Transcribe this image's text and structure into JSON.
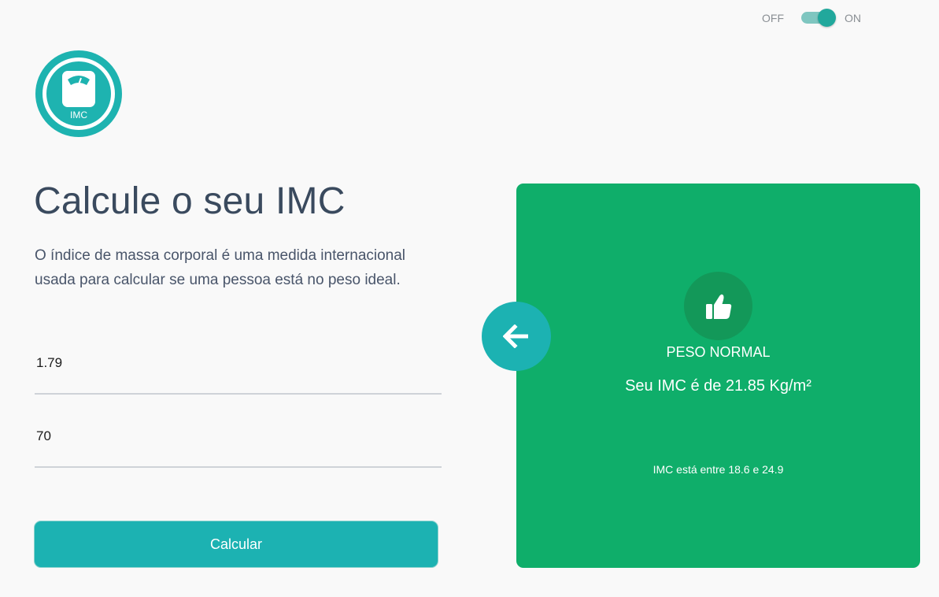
{
  "theme_toggle": {
    "off_label": "OFF",
    "on_label": "ON",
    "state": "on"
  },
  "logo": {
    "text": "IMC",
    "icon": "scale-icon",
    "color": "#1eb3b0"
  },
  "main": {
    "title": "Calcule o seu IMC",
    "description": "O índice de massa corporal é uma medida internacional usada para calcular se uma pessoa está no peso ideal."
  },
  "form": {
    "height_value": "1.79",
    "weight_value": "70",
    "submit_label": "Calcular"
  },
  "result": {
    "status": "PESO NORMAL",
    "value_text": "Seu IMC é de 21.85 Kg/m²",
    "range_text": "IMC está entre 18.6 e 24.9",
    "icon": "thumbs-up-icon",
    "card_color": "#0fae6a"
  },
  "back_button": {
    "icon": "arrow-left-icon",
    "color": "#1cb2b2"
  }
}
